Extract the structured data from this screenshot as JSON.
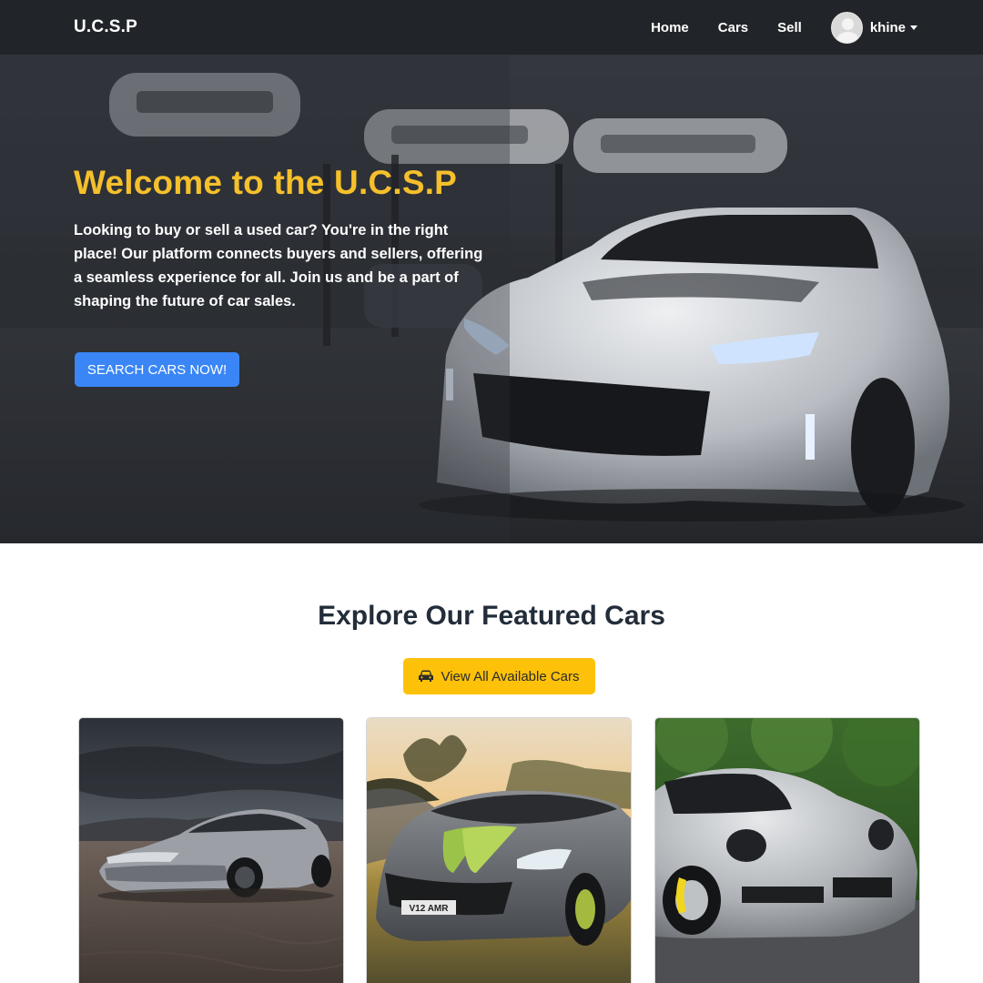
{
  "navbar": {
    "brand": "U.C.S.P",
    "links": [
      "Home",
      "Cars",
      "Sell"
    ],
    "username": "khine"
  },
  "hero": {
    "title": "Welcome to the U.C.S.P",
    "text": "Looking to buy or sell a used car? You're in the right place! Our platform connects buyers and sellers, offering a seamless experience for all. Join us and be a part of shaping the future of car sales.",
    "button_label": "SEARCH CARS NOW!"
  },
  "featured": {
    "title": "Explore Our Featured Cars",
    "button_label": "View All Available Cars",
    "cards": [
      {
        "image": "silver sedan on desert dunes"
      },
      {
        "image": "grey sports car with green stripe",
        "plate": "V12 AMR"
      },
      {
        "image": "silver sports coupe with yellow calipers"
      }
    ]
  },
  "colors": {
    "navbar": "#212529",
    "accent_yellow": "#fdc10a",
    "hero_title": "#f5c02b",
    "primary_blue": "#3a86f7",
    "heading": "#232d3a"
  }
}
